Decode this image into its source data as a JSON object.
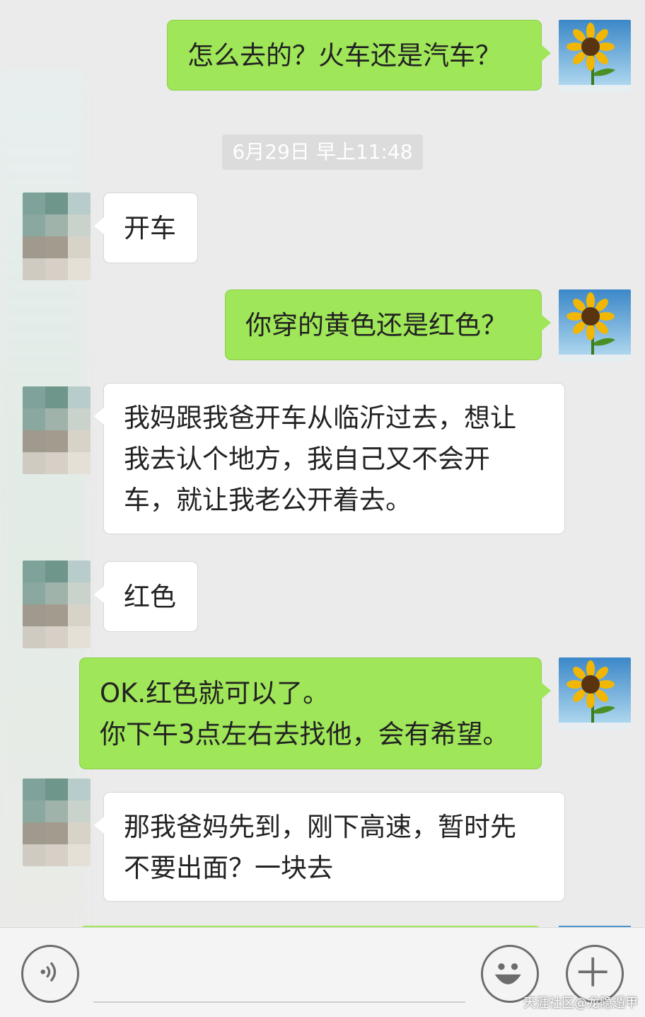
{
  "messages": [
    {
      "side": "out",
      "lines": [
        "怎么去的？火车还是汽车？"
      ]
    },
    {
      "side": "in",
      "lines": [
        "开车"
      ]
    },
    {
      "side": "out",
      "lines": [
        "你穿的黄色还是红色？"
      ]
    },
    {
      "side": "in",
      "lines": [
        "我妈跟我爸开车从临沂过去，想让",
        "我去认个地方，我自己又不会开",
        "车，就让我老公开着去。"
      ]
    },
    {
      "side": "in",
      "lines": [
        "红色"
      ]
    },
    {
      "side": "out",
      "lines": [
        "OK.红色就可以了。",
        "你下午3点左右去找他，会有希望。"
      ]
    },
    {
      "side": "in",
      "lines": [
        "那我爸妈先到，刚下高速，暂时先",
        "不要出面？一块去"
      ]
    }
  ],
  "timestamp": "6月29日 早上11:48",
  "input_bar": {
    "voice_icon": "voice-wave-icon",
    "emoji_icon": "smiley-face-icon",
    "plus_icon": "plus-icon"
  },
  "watermark": "天涯社区@龙隐遁甲",
  "colors": {
    "outgoing_bubble": "#9fe658",
    "incoming_bubble": "#ffffff",
    "background": "#ebebeb",
    "timestamp_bg": "#dcdcdc"
  }
}
